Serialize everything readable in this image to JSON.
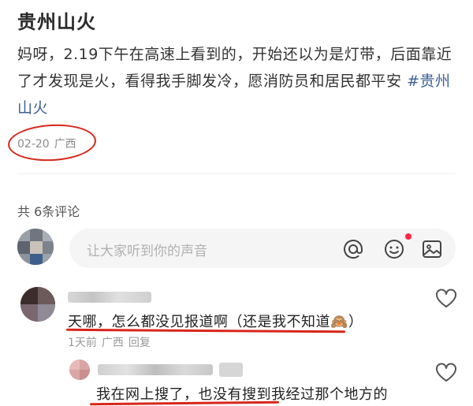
{
  "post": {
    "title": "贵州山火",
    "body_text": "妈呀，2.19下午在高速上看到的，开始还以为是灯带，后面靠近了才发现是火，看得我手脚发冷，愿消防员和居民都平安",
    "hashtag": "#贵州山火",
    "date": "02-20",
    "location": "广西"
  },
  "comments_section": {
    "count_label": "共 6条评论",
    "input_placeholder": "让大家听到你的声音",
    "icons": [
      "at-icon",
      "emoji-icon",
      "image-icon"
    ]
  },
  "comments": [
    {
      "text": "天哪，怎么都没见报道啊（还是我不知道",
      "emoji": "🙈",
      "text_end": "）",
      "time": "1天前",
      "location": "广西",
      "reply_label": "回复"
    },
    {
      "text": "我在网上搜了，也没有搜到我经过那个地方的"
    }
  ],
  "colors": {
    "annotation_red": "#d8261a",
    "hashtag_blue": "#3d5f96",
    "notification_red": "#ff2442"
  }
}
